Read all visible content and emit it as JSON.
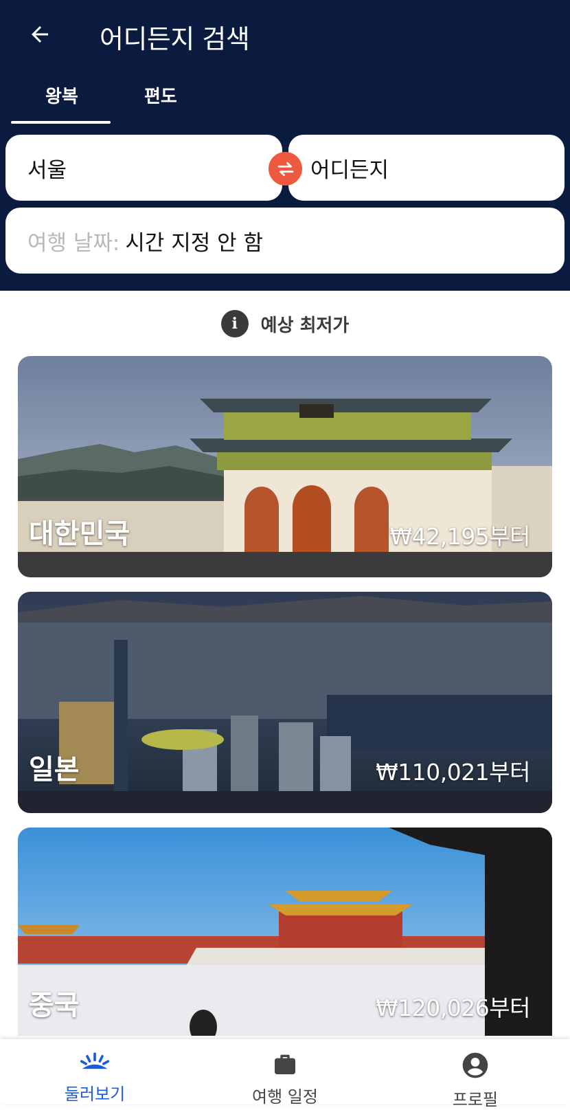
{
  "header": {
    "back_icon": "arrow-left-icon",
    "title": "어디든지 검색",
    "tabs": [
      {
        "label": "왕복",
        "selected": true
      },
      {
        "label": "편도",
        "selected": false
      }
    ]
  },
  "search": {
    "origin": "서울",
    "destination": "어디든지",
    "swap_icon": "swap-arrows-icon",
    "date_label": "여행 날짜:",
    "date_value": "시간 지정 안 함"
  },
  "info": {
    "icon": "info-icon",
    "text": "예상 최저가"
  },
  "destinations": [
    {
      "name": "대한민국",
      "price": "₩42,195부터"
    },
    {
      "name": "일본",
      "price": "₩110,021부터"
    },
    {
      "name": "중국",
      "price": "₩120,026부터"
    }
  ],
  "bottom_nav": [
    {
      "label": "둘러보기",
      "icon": "explore-sunrise-icon",
      "active": true
    },
    {
      "label": "여행 일정",
      "icon": "briefcase-icon",
      "active": false
    },
    {
      "label": "프로필",
      "icon": "account-circle-icon",
      "active": false
    }
  ],
  "colors": {
    "header_bg": "#0b1b3f",
    "accent_orange": "#ee5a3f",
    "active_blue": "#1a5bd8"
  }
}
